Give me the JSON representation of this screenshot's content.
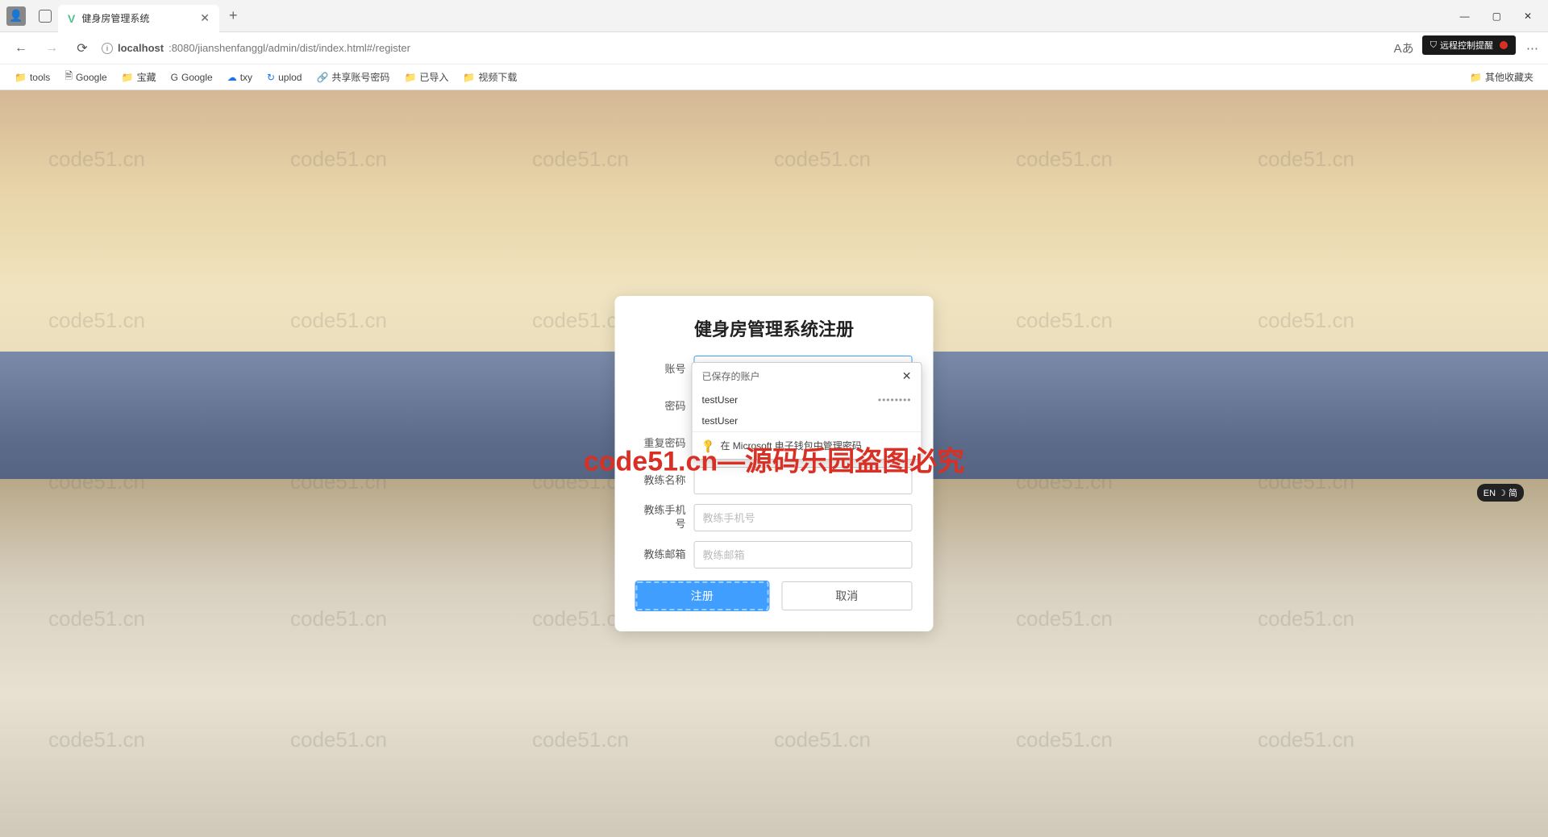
{
  "browser": {
    "tab_title": "健身房管理系统",
    "url_host": "localhost",
    "url_path": ":8080/jianshenfanggl/admin/dist/index.html#/register",
    "win_min": "—",
    "win_max": "▢",
    "win_close": "✕",
    "new_tab": "+",
    "tab_close": "✕",
    "back": "←",
    "fwd": "→",
    "reload": "⟳"
  },
  "toolbar_icons": {
    "a_read": "Aあ",
    "star": "☆",
    "ext": "⊞",
    "collect": "⧉",
    "sync": "↻",
    "menu": "⋯"
  },
  "notif": {
    "label": "远程控制提醒",
    "shield": "⛉"
  },
  "bookmarks": [
    {
      "icon": "📁",
      "label": "tools",
      "cls": "f-yellow"
    },
    {
      "icon": "🗎",
      "label": "Google",
      "cls": ""
    },
    {
      "icon": "📁",
      "label": "宝藏",
      "cls": "f-yellow"
    },
    {
      "icon": "G",
      "label": "Google",
      "cls": ""
    },
    {
      "icon": "☁",
      "label": "txy",
      "cls": "f-blue"
    },
    {
      "icon": "↻",
      "label": "uplod",
      "cls": "f-blue"
    },
    {
      "icon": "🔗",
      "label": "共享账号密码",
      "cls": "f-blue"
    },
    {
      "icon": "📁",
      "label": "已导入",
      "cls": "f-yellow"
    },
    {
      "icon": "📁",
      "label": "视频下载",
      "cls": "f-yellow"
    }
  ],
  "bookmarks_overflow": "其他收藏夹",
  "form": {
    "title": "健身房管理系统注册",
    "fields": {
      "account": {
        "label": "账号",
        "value": "testUser",
        "placeholder": ""
      },
      "password": {
        "label": "密码",
        "value": "",
        "placeholder": ""
      },
      "repeat": {
        "label": "重复密码",
        "value": "",
        "placeholder": ""
      },
      "coach_name": {
        "label": "教练名称",
        "value": "",
        "placeholder": ""
      },
      "coach_phone": {
        "label": "教练手机号",
        "value": "",
        "placeholder": "教练手机号"
      },
      "coach_email": {
        "label": "教练邮箱",
        "value": "",
        "placeholder": "教练邮箱"
      }
    },
    "register_btn": "注册",
    "cancel_btn": "取消"
  },
  "autofill": {
    "header": "已保存的账户",
    "close": "✕",
    "items": [
      {
        "user": "testUser",
        "mask": "••••••••"
      },
      {
        "user": "testUser",
        "mask": ""
      }
    ],
    "manage": "在 Microsoft 电子钱包中管理密码",
    "key": "🔑"
  },
  "watermark": {
    "text": "code51.cn",
    "red": "code51.cn—源码乐园盗图必究"
  },
  "ime": {
    "label": "EN ☽ 简"
  }
}
